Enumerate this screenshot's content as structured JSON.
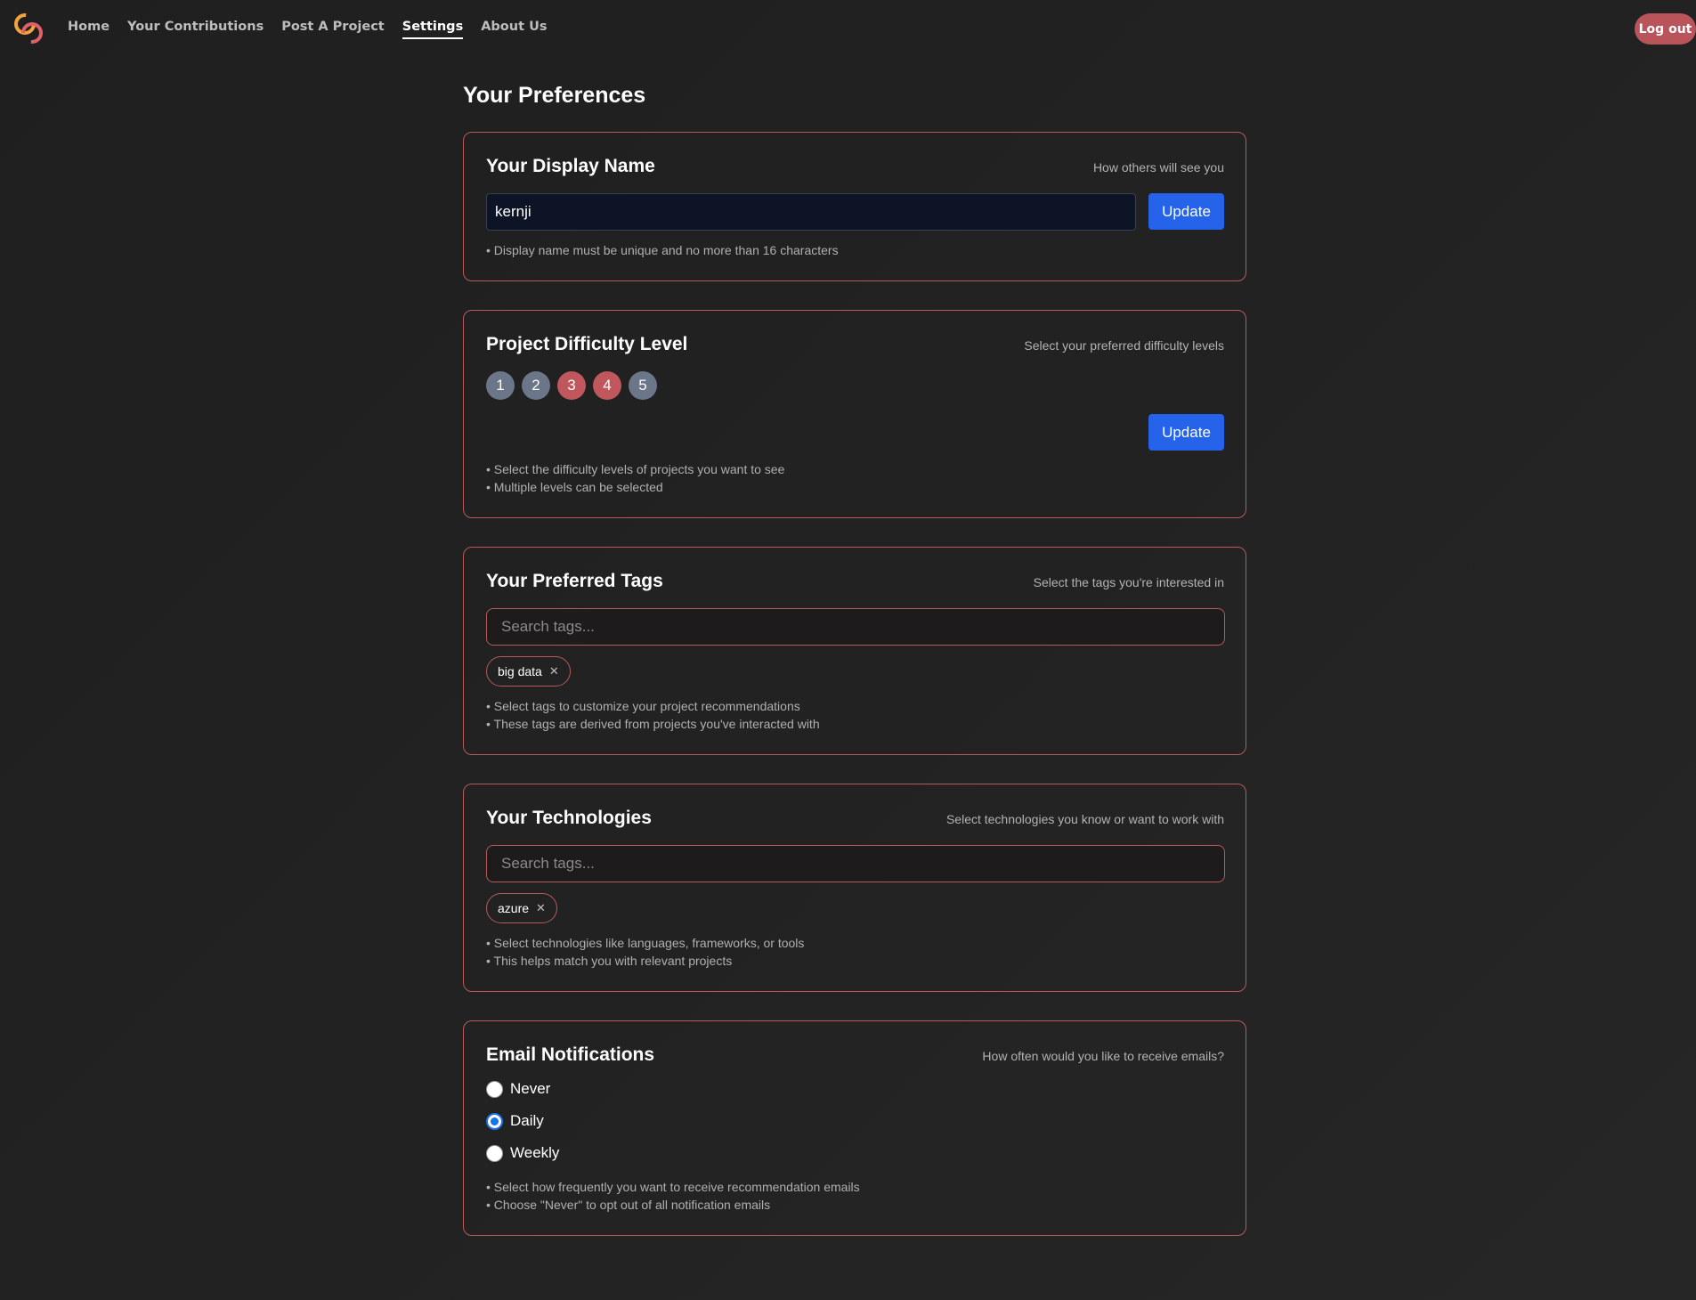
{
  "nav": {
    "links": [
      "Home",
      "Your Contributions",
      "Post A Project",
      "Settings",
      "About Us"
    ],
    "active": "Settings",
    "logout": "Log out"
  },
  "page": {
    "title": "Your Preferences"
  },
  "display_name": {
    "title": "Your Display Name",
    "subtitle": "How others will see you",
    "value": "kernji",
    "button": "Update",
    "hint": "• Display name must be unique and no more than 16 characters"
  },
  "difficulty": {
    "title": "Project Difficulty Level",
    "subtitle": "Select your preferred difficulty levels",
    "levels": [
      "1",
      "2",
      "3",
      "4",
      "5"
    ],
    "selected": [
      "3",
      "4"
    ],
    "button": "Update",
    "hints": [
      "• Select the difficulty levels of projects you want to see",
      "• Multiple levels can be selected"
    ]
  },
  "tags": {
    "title": "Your Preferred Tags",
    "subtitle": "Select the tags you're interested in",
    "placeholder": "Search tags...",
    "chips": [
      "big data"
    ],
    "hints": [
      "• Select tags to customize your project recommendations",
      "• These tags are derived from projects you've interacted with"
    ]
  },
  "technologies": {
    "title": "Your Technologies",
    "subtitle": "Select technologies you know or want to work with",
    "placeholder": "Search tags...",
    "chips": [
      "azure"
    ],
    "hints": [
      "• Select technologies like languages, frameworks, or tools",
      "• This helps match you with relevant projects"
    ]
  },
  "email": {
    "title": "Email Notifications",
    "subtitle": "How often would you like to receive emails?",
    "options": [
      "Never",
      "Daily",
      "Weekly"
    ],
    "selected": "Daily",
    "hints": [
      "• Select how frequently you want to receive recommendation emails",
      "• Choose \"Never\" to opt out of all notification emails"
    ]
  },
  "icons": {
    "logo": "app-logo-icon",
    "chip_remove": "close-icon"
  },
  "colors": {
    "accent": "#b65a5a",
    "primary_button": "#2563eb",
    "level_selected": "#c0575c",
    "level_unselected": "#6b7688"
  }
}
